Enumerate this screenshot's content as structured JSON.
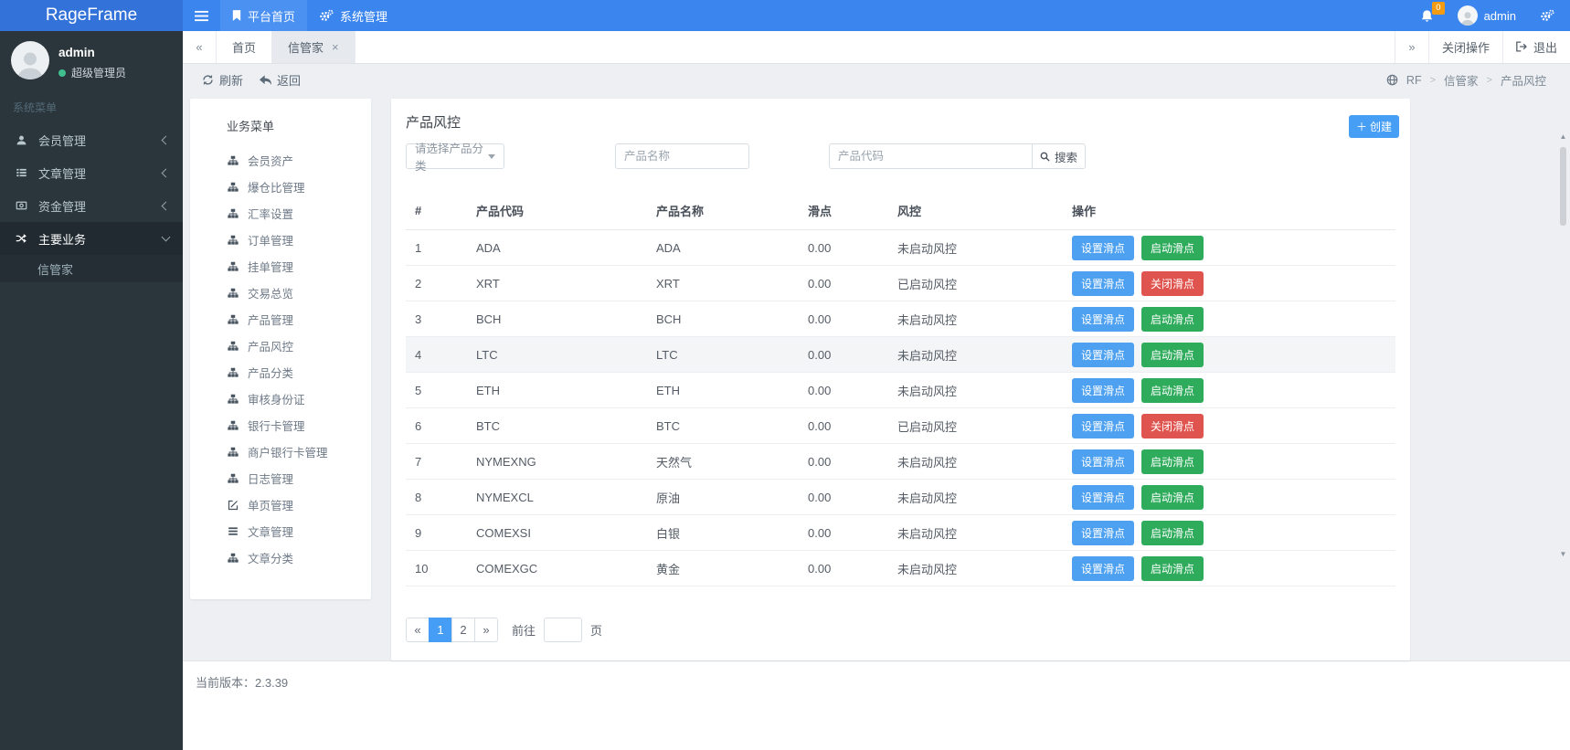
{
  "colors": {
    "accent": "#3b86ee",
    "success": "#2eab5b",
    "danger": "#e0544f",
    "warning": "#f39c12"
  },
  "navbar": {
    "brand": "RageFrame",
    "items": [
      {
        "label": "平台首页"
      },
      {
        "label": "系统管理"
      }
    ],
    "notification_count": "0",
    "user": "admin"
  },
  "sidebar": {
    "user": {
      "name": "admin",
      "role": "超级管理员"
    },
    "section_label": "系统菜单",
    "items": [
      {
        "key": "members",
        "label": "会员管理",
        "icon": "user",
        "active": false
      },
      {
        "key": "articles",
        "label": "文章管理",
        "icon": "article",
        "active": false
      },
      {
        "key": "funds",
        "label": "资金管理",
        "icon": "money",
        "active": false
      },
      {
        "key": "business",
        "label": "主要业务",
        "icon": "shuffle",
        "active": true
      }
    ],
    "subitems": [
      {
        "key": "xinguanjia",
        "label": "信管家"
      }
    ]
  },
  "tabbar": {
    "prev": "«",
    "next": "»",
    "tabs": [
      {
        "label": "首页",
        "active": false,
        "closable": false
      },
      {
        "label": "信管家",
        "active": true,
        "closable": true
      }
    ],
    "close_symbol": "×",
    "close_ops": "关闭操作",
    "logout": "退出"
  },
  "toolbar": {
    "refresh": "刷新",
    "back": "返回",
    "breadcrumb": [
      "RF",
      "信管家",
      "产品风控"
    ]
  },
  "business_menu": {
    "title": "业务菜单",
    "items": [
      {
        "label": "会员资产",
        "icon": "sitemap"
      },
      {
        "label": "爆仓比管理",
        "icon": "sitemap"
      },
      {
        "label": "汇率设置",
        "icon": "sitemap"
      },
      {
        "label": "订单管理",
        "icon": "sitemap"
      },
      {
        "label": "挂单管理",
        "icon": "sitemap"
      },
      {
        "label": "交易总览",
        "icon": "sitemap"
      },
      {
        "label": "产品管理",
        "icon": "sitemap"
      },
      {
        "label": "产品风控",
        "icon": "sitemap"
      },
      {
        "label": "产品分类",
        "icon": "sitemap"
      },
      {
        "label": "审核身份证",
        "icon": "sitemap"
      },
      {
        "label": "银行卡管理",
        "icon": "sitemap"
      },
      {
        "label": "商户银行卡管理",
        "icon": "sitemap"
      },
      {
        "label": "日志管理",
        "icon": "sitemap"
      },
      {
        "label": "单页管理",
        "icon": "edit"
      },
      {
        "label": "文章管理",
        "icon": "list"
      },
      {
        "label": "文章分类",
        "icon": "sitemap"
      }
    ]
  },
  "main": {
    "title": "产品风控",
    "create_label": "创建",
    "filters": {
      "category_placeholder": "请选择产品分类",
      "name_placeholder": "产品名称",
      "code_placeholder": "产品代码",
      "search_label": "搜索"
    },
    "table": {
      "headers": [
        "#",
        "产品代码",
        "产品名称",
        "滑点",
        "风控",
        "操作"
      ],
      "action_set": "设置滑点",
      "action_start": "启动滑点",
      "action_stop": "关闭滑点",
      "rows": [
        {
          "idx": "1",
          "code": "ADA",
          "name": "ADA",
          "slip": "0.00",
          "risk": "未启动风控",
          "started": false,
          "highlighted": false
        },
        {
          "idx": "2",
          "code": "XRT",
          "name": "XRT",
          "slip": "0.00",
          "risk": "已启动风控",
          "started": true,
          "highlighted": false
        },
        {
          "idx": "3",
          "code": "BCH",
          "name": "BCH",
          "slip": "0.00",
          "risk": "未启动风控",
          "started": false,
          "highlighted": false
        },
        {
          "idx": "4",
          "code": "LTC",
          "name": "LTC",
          "slip": "0.00",
          "risk": "未启动风控",
          "started": false,
          "highlighted": true
        },
        {
          "idx": "5",
          "code": "ETH",
          "name": "ETH",
          "slip": "0.00",
          "risk": "未启动风控",
          "started": false,
          "highlighted": false
        },
        {
          "idx": "6",
          "code": "BTC",
          "name": "BTC",
          "slip": "0.00",
          "risk": "已启动风控",
          "started": true,
          "highlighted": false
        },
        {
          "idx": "7",
          "code": "NYMEXNG",
          "name": "天然气",
          "slip": "0.00",
          "risk": "未启动风控",
          "started": false,
          "highlighted": false
        },
        {
          "idx": "8",
          "code": "NYMEXCL",
          "name": "原油",
          "slip": "0.00",
          "risk": "未启动风控",
          "started": false,
          "highlighted": false
        },
        {
          "idx": "9",
          "code": "COMEXSI",
          "name": "白银",
          "slip": "0.00",
          "risk": "未启动风控",
          "started": false,
          "highlighted": false
        },
        {
          "idx": "10",
          "code": "COMEXGC",
          "name": "黄金",
          "slip": "0.00",
          "risk": "未启动风控",
          "started": false,
          "highlighted": false
        }
      ]
    },
    "pagination": {
      "prev": "«",
      "pages": [
        "1",
        "2"
      ],
      "active": "1",
      "next": "»",
      "goto_label": "前往",
      "page_unit": "页",
      "goto_value": ""
    }
  },
  "footer": {
    "version_label": "当前版本：",
    "version": "2.3.39"
  }
}
